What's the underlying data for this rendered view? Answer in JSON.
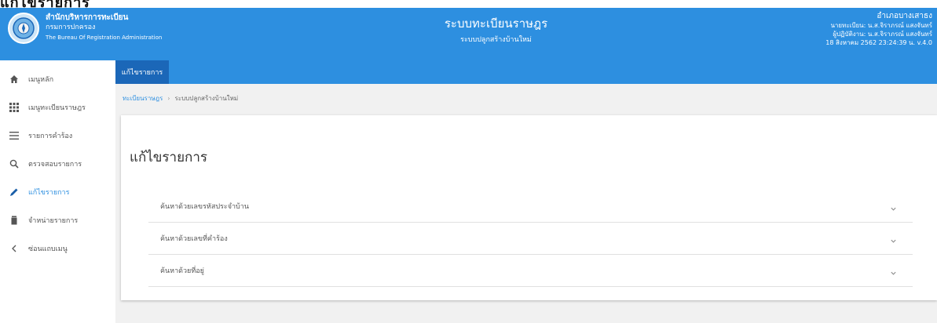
{
  "page_caption": "แก้ไขรายการ",
  "header": {
    "org_line1": "สำนักบริหารการทะเบียน",
    "org_line2": "กรมการปกครอง",
    "org_line3": "The Bureau Of Registration Administration",
    "system_title": "ระบบทะเบียนราษฎร",
    "system_subtitle": "ระบบปลูกสร้างบ้านใหม่",
    "user_office": "อำเภอบางเสาธง",
    "user_line2": "นายทะเบียน: น.ส.จิราภรณ์ แสงจันทร์",
    "user_line3": "ผู้ปฏิบัติงาน: น.ส.จิราภรณ์ แสงจันทร์",
    "datetime": "18 สิงหาคม 2562 23:24:39 น. v.4.0"
  },
  "sidebar": {
    "items": [
      {
        "label": "เมนูหลัก",
        "icon": "home-icon"
      },
      {
        "label": "เมนูทะเบียนราษฎร",
        "icon": "grid-icon"
      },
      {
        "label": "รายการคำร้อง",
        "icon": "list-icon"
      },
      {
        "label": "ตรวจสอบรายการ",
        "icon": "search-icon"
      },
      {
        "label": "แก้ไขรายการ",
        "icon": "pencil-icon",
        "active": true
      },
      {
        "label": "จำหน่ายรายการ",
        "icon": "trash-icon"
      },
      {
        "label": "ซ่อนแถบเมนู",
        "icon": "chevron-left-icon"
      }
    ]
  },
  "tabs": [
    {
      "label": "แก้ไขรายการ",
      "active": true
    }
  ],
  "breadcrumb": {
    "items": [
      "ทะเบียนราษฎร",
      "ระบบปลูกสร้างบ้านใหม่"
    ]
  },
  "main": {
    "title": "แก้ไขรายการ",
    "accordion": [
      {
        "label": "ค้นหาด้วยเลขรหัสประจำบ้าน"
      },
      {
        "label": "ค้นหาด้วยเลขที่คำร้อง"
      },
      {
        "label": "ค้นหาด้วยที่อยู่"
      }
    ]
  },
  "colors": {
    "header": "#2d8fe0",
    "tab_active": "#1b67b8",
    "content_bg": "#f1f1f1"
  }
}
